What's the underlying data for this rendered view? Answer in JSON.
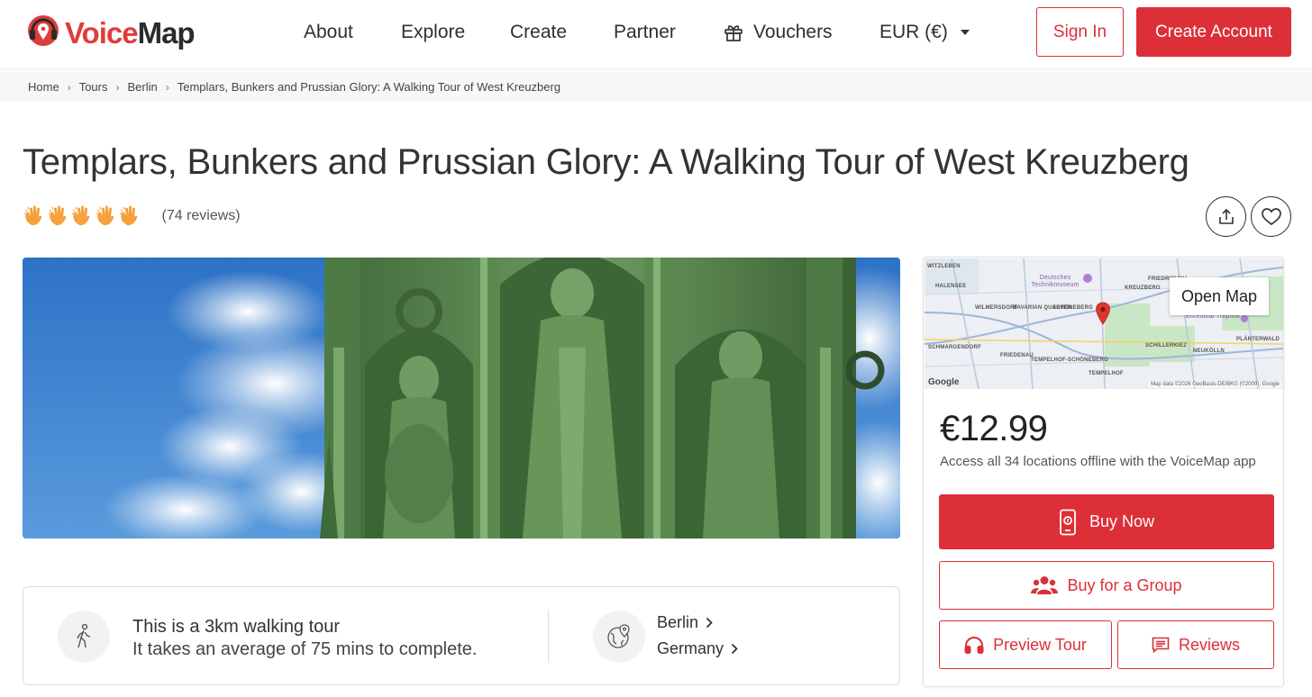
{
  "header": {
    "logo_text_voice": "Voice",
    "logo_text_map": "Map",
    "nav": {
      "about": "About",
      "explore": "Explore",
      "create": "Create",
      "partner": "Partner",
      "vouchers": "Vouchers",
      "currency": "EUR (€)"
    },
    "sign_in": "Sign In",
    "create_account": "Create Account"
  },
  "breadcrumb": [
    "Home",
    "Tours",
    "Berlin",
    "Templars, Bunkers and Prussian Glory: A Walking Tour of West Kreuzberg"
  ],
  "tour": {
    "title": "Templars, Bunkers and Prussian Glory: A Walking Tour of West Kreuzberg",
    "rating": 5,
    "reviews_label": "(74 reviews)",
    "distance_text": "This is a 3km walking tour",
    "duration_text": "It takes an average of 75 mins to complete.",
    "city": "Berlin",
    "country": "Germany"
  },
  "sidebar": {
    "open_map": "Open Map",
    "map_google": "Google",
    "map_attribution": "Map data ©2026 GeoBasis-DE/BKG (©2009), Google",
    "map_labels": {
      "witzleben": "WITZLEBEN",
      "halensee": "HALENSEE",
      "wilmersdorf": "WILMERSDORF",
      "bavarian_quarter": "BAVARIAN QUARTER",
      "schoneberg": "SCHÖNEBERG",
      "schmargendorf": "SCHMARGENDORF",
      "friedenau": "FRIEDENAU",
      "tempelhof_schoneberg": "TEMPELHOF-SCHÖNEBERG",
      "tempelhof": "TEMPELHOF",
      "schillerkiez": "SCHILLERKIEZ",
      "neukolln": "NEUKÖLLN",
      "plantewald": "PLÄNTERWALD",
      "kreuzberg": "KREUZBERG",
      "friedrichshain": "FRIEDRICHSH",
      "museum": "Deutsches Technikmuseum",
      "treptow": "Ehrenmal Treptow"
    },
    "price": "€12.99",
    "access_text": "Access all 34 locations offline with the VoiceMap app",
    "buy_now": "Buy Now",
    "buy_group": "Buy for a Group",
    "preview": "Preview Tour",
    "reviews": "Reviews"
  },
  "colors": {
    "brand_red": "#dc2f37",
    "text_dark": "#333333",
    "clap_orange": "#f5a13d"
  },
  "icons": [
    "voicemap-logo-icon",
    "gift-icon",
    "caret-down-icon",
    "chevron-right-icon",
    "clap-icon",
    "share-icon",
    "heart-icon",
    "walking-icon",
    "globe-pin-icon",
    "phone-icon",
    "group-icon",
    "headphones-icon",
    "reviews-icon",
    "map-pin-icon"
  ]
}
